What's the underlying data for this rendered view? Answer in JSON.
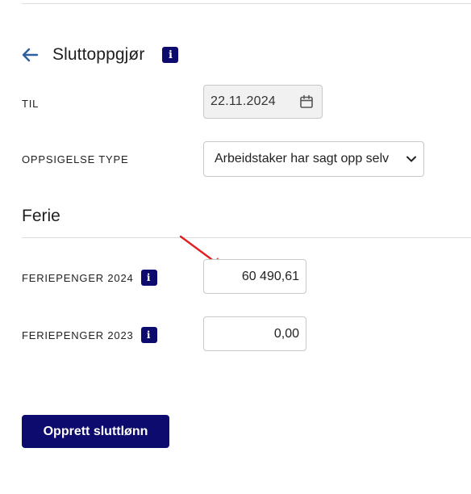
{
  "header": {
    "title": "Sluttoppgjør",
    "info_icon": "info-icon",
    "back_icon": "arrow-left-icon"
  },
  "form": {
    "til": {
      "label": "TIL",
      "value": "22.11.2024",
      "icon": "calendar-icon"
    },
    "oppsigelse_type": {
      "label": "OPPSIGELSE TYPE",
      "value": "Arbeidstaker har sagt opp selv"
    }
  },
  "ferie": {
    "section_title": "Ferie",
    "feriepenger_2024": {
      "label": "FERIEPENGER 2024",
      "value": "60 490,61"
    },
    "feriepenger_2023": {
      "label": "FERIEPENGER 2023",
      "value": "0,00"
    }
  },
  "actions": {
    "submit_label": "Opprett sluttlønn"
  },
  "colors": {
    "brand": "#0d0b6e",
    "back_arrow": "#2f5f9e",
    "annotation": "#e02020"
  }
}
